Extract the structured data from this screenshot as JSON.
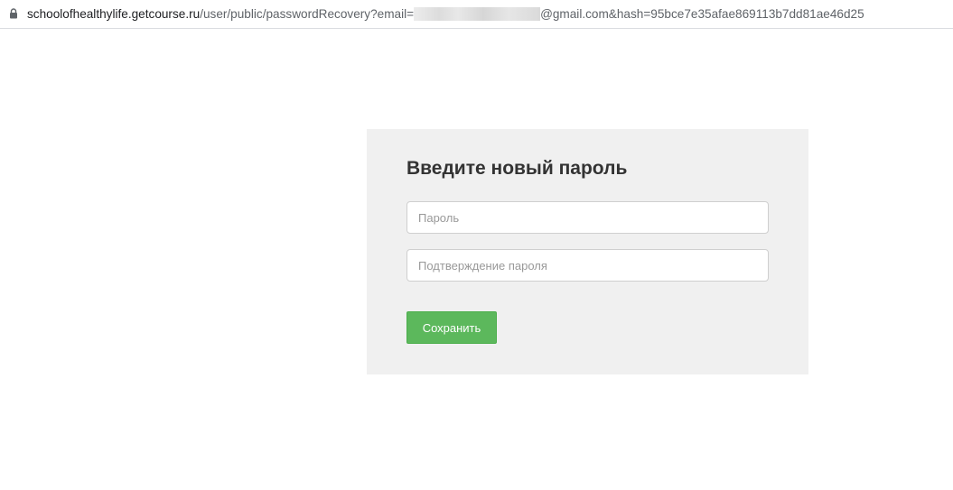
{
  "browser": {
    "url_host": "schoolofhealthylife.getcourse.ru",
    "url_path": "/user/public/passwordRecovery?email=",
    "url_suffix": "@gmail.com&hash=95bce7e35afae869113b7dd81ae46d25",
    "lock_icon": "lock-icon"
  },
  "form": {
    "title": "Введите новый пароль",
    "password_placeholder": "Пароль",
    "password_value": "",
    "confirm_placeholder": "Подтверждение пароля",
    "confirm_value": "",
    "save_label": "Сохранить"
  },
  "colors": {
    "panel_bg": "#f0f0f0",
    "save_button": "#5cb85c"
  }
}
